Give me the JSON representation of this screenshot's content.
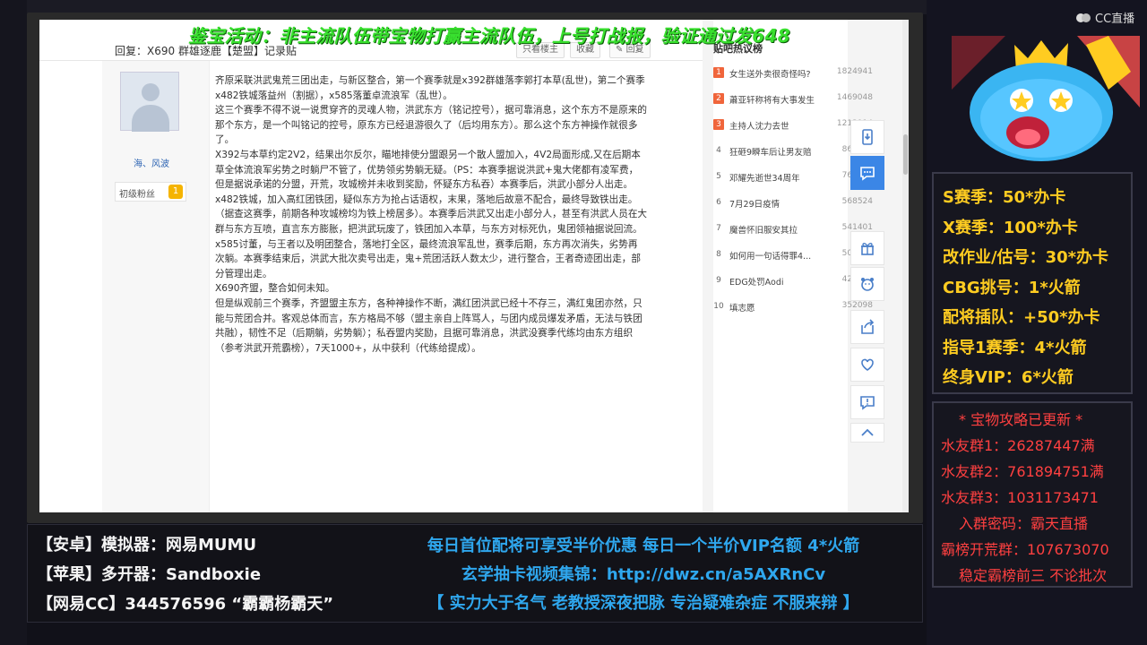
{
  "overlay": {
    "banner": "鉴宝活动：非主流队伍带宝物打赢主流队伍，上号打战报，验证通过发648",
    "cc_logo": "CC直播"
  },
  "forum": {
    "reply_title": "回复：X690 群雄逐鹿【楚盟】记录贴",
    "buttons": {
      "only_owner": "只看楼主",
      "favorite": "收藏",
      "reply": "回复"
    },
    "author": {
      "name": "海、风波",
      "level_label": "初级粉丝",
      "level_num": "1"
    },
    "post_paragraphs": [
      "齐原采联洪武鬼荒三团出走，与新区整合，第一个赛季就是x392群雄落李郭打本草(乱世)，第二个赛季x482铁城落益州（割据），x585落董卓流浪军（乱世）。",
      "这三个赛季不得不说一说贯穿齐的灵魂人物，洪武东方（铭记控号），据可靠消息，这个东方不是原来的那个东方，是一个叫铭记的控号，原东方已经退游很久了（后均用东方）。那么这个东方神操作就很多了。",
      "X392与本草约定2V2，结果出尔反尔，瞄地排使分盟跟另一个散人盟加入，4V2局面形成,又在后期本草全体流浪军劣势之时躺尸不管了，优势领劣势躺无疑。（PS：本赛季据说洪武+鬼大佬都有凌军费，但是据说承诺的分盟，开荒，攻城榜并未收到奖励，怀疑东方私吞）本赛季后，洪武小部分人出走。",
      "x482铁城，加入高红团铁团，疑似东方为抢占话语权，末果，落地后故意不配合，最终导致铁出走。（据查这赛季，前期各种攻城榜均为铁上榜居多）。本赛季后洪武又出走小部分人，甚至有洪武人员在大群与东方互喷，直言东方膨胀，把洪武玩废了，铁团加入本草，与东方对标死仇，鬼团领袖据说回流。",
      "x585讨董，与王者以及明团整合，落地打全区，最终流浪军乱世，赛季后期，东方再次消失，劣势再次躺。本赛季结束后，洪武大批次卖号出走，鬼+荒团活跃人数太少，进行整合，王者奇迹团出走，部分管理出走。",
      "X690齐盟，整合如何未知。",
      "但是纵观前三个赛季，齐盟盟主东方，各种神操作不断，满红团洪武已经十不存三，满红鬼团亦然，只能与荒团合并。客观总体而言，东方格局不够（盟主亲自上阵骂人，与团内成员爆发矛盾，无法与铁团共融），韧性不足（后期躺，劣势躺）；私吞盟内奖励，且据可靠消息，洪武没赛季代练均由东方组织（参考洪武开荒霸榜），7天1000+，从中获利（代练给提成）。"
    ]
  },
  "hot_list": {
    "title": "贴吧热议榜",
    "items": [
      {
        "rank": "1",
        "text": "女生送外卖很奇怪吗?",
        "count": "1824941"
      },
      {
        "rank": "2",
        "text": "蕭亚轩称将有大事发生",
        "count": "1469048"
      },
      {
        "rank": "3",
        "text": "主持人沈力去世",
        "count": "1213914"
      },
      {
        "rank": "4",
        "text": "狂砸9瞬车后让男友赔",
        "count": "861400"
      },
      {
        "rank": "5",
        "text": "邓耀先逝世34周年",
        "count": "765647"
      },
      {
        "rank": "6",
        "text": "7月29日疫情",
        "count": "568524"
      },
      {
        "rank": "7",
        "text": "魔兽怀旧服安其拉",
        "count": "541401"
      },
      {
        "rank": "8",
        "text": "如何用一句话得罪4...",
        "count": "504360"
      },
      {
        "rank": "9",
        "text": "EDG处罚Aodi",
        "count": "426436"
      },
      {
        "rank": "10",
        "text": "填志愿",
        "count": "352098"
      }
    ]
  },
  "prices": [
    "S赛季：50*办卡",
    "X赛季：100*办卡",
    "改作业/估号：30*办卡",
    "CBG挑号：1*火箭",
    "配将插队：+50*办卡",
    "指导1赛季：4*火箭",
    "终身VIP：6*火箭"
  ],
  "groups": [
    "* 宝物攻略已更新 *",
    "水友群1：26287447满",
    "水友群2：761894751满",
    "水友群3：1031173471",
    "入群密码：霸天直播",
    "霸榜开荒群：107673070",
    "稳定霸榜前三 不论批次"
  ],
  "bottom_left": [
    "【安卓】模拟器：网易MUMU",
    "【苹果】多开器：Sandboxie",
    "【网易CC】344576596 “霸霸杨霸天”"
  ],
  "bottom_right": [
    "每日首位配将可享受半价优惠 每日一个半价VIP名额 4*火箭",
    "玄学抽卡视频集锦：http://dwz.cn/a5AXRnCv",
    "【 实力大于名气 老教授深夜把脉 专治疑难杂症 不服来辩 】"
  ],
  "colors": {
    "banner": "#39e02f",
    "price": "#ffcc21",
    "group": "#ff4040",
    "promo": "#2fa7ee",
    "tool_active": "#3b86e6"
  }
}
